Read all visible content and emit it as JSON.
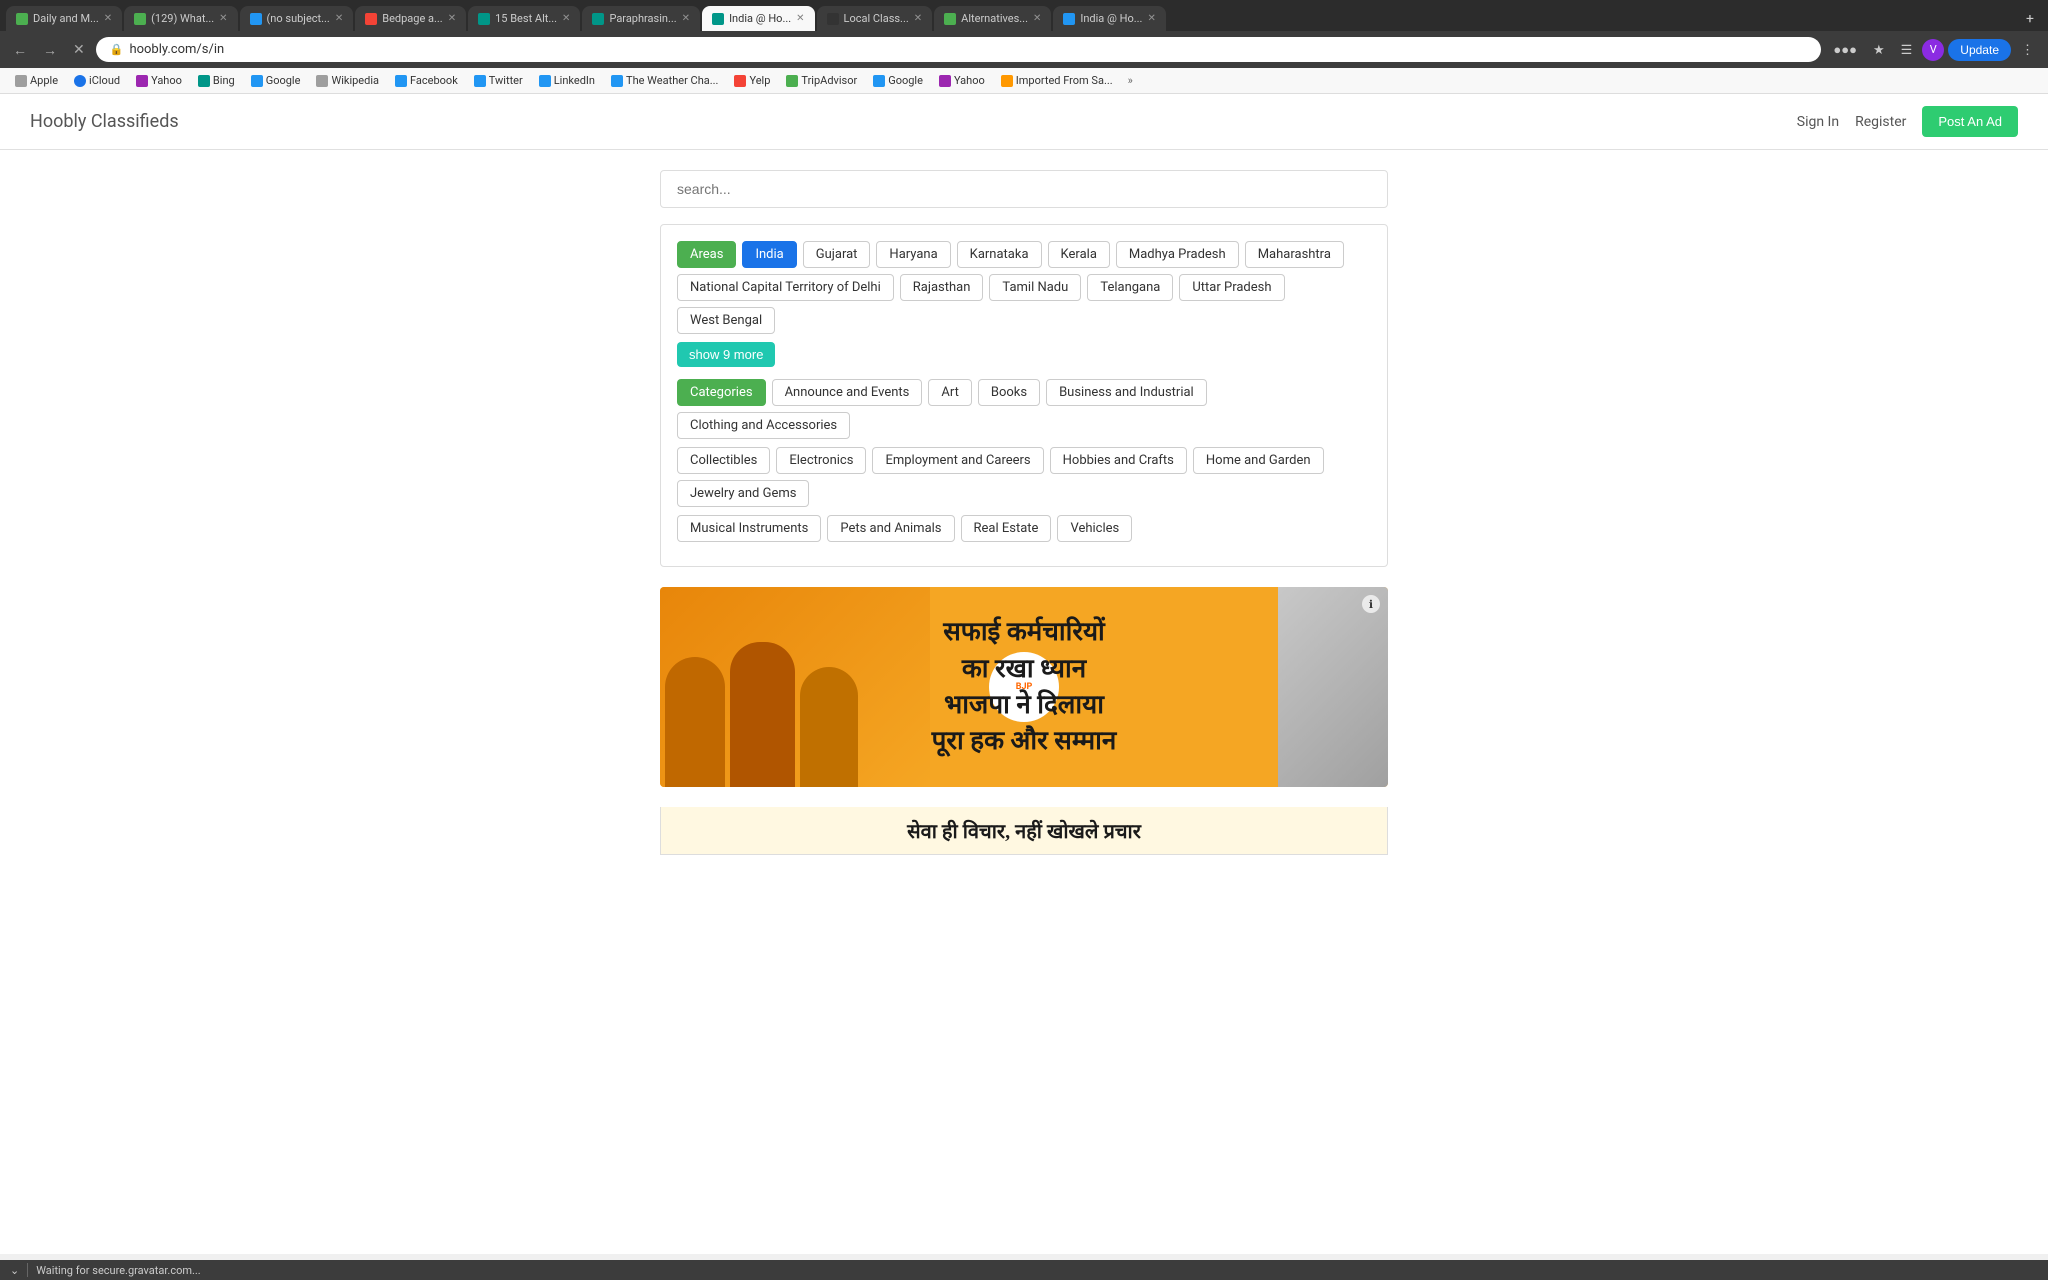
{
  "browser": {
    "tabs": [
      {
        "id": 1,
        "title": "Daily and M...",
        "favicon_color": "fav-green",
        "active": false,
        "closeable": true
      },
      {
        "id": 2,
        "title": "(129) What...",
        "favicon_color": "fav-green",
        "active": false,
        "closeable": true
      },
      {
        "id": 3,
        "title": "(no subject...",
        "favicon_color": "fav-blue",
        "active": false,
        "closeable": true
      },
      {
        "id": 4,
        "title": "Bedpage a...",
        "favicon_color": "fav-red",
        "active": false,
        "closeable": true
      },
      {
        "id": 5,
        "title": "15 Best Alt...",
        "favicon_color": "fav-teal",
        "active": false,
        "closeable": true
      },
      {
        "id": 6,
        "title": "Paraphrasin...",
        "favicon_color": "fav-teal",
        "active": false,
        "closeable": true
      },
      {
        "id": 7,
        "title": "India @ Ho...",
        "favicon_color": "fav-teal",
        "active": true,
        "closeable": true
      },
      {
        "id": 8,
        "title": "Local Class...",
        "favicon_color": "fav-dark",
        "active": false,
        "closeable": true
      },
      {
        "id": 9,
        "title": "Alternatives...",
        "favicon_color": "fav-green",
        "active": false,
        "closeable": true
      },
      {
        "id": 10,
        "title": "India @ Ho...",
        "favicon_color": "fav-blue",
        "active": false,
        "closeable": true
      }
    ],
    "url": "hoobly.com/s/in",
    "update_label": "Update"
  },
  "bookmarks": [
    {
      "label": "Apple",
      "favicon_color": "fav-gray"
    },
    {
      "label": "iCloud",
      "favicon_color": "fav-circle-blue"
    },
    {
      "label": "Yahoo",
      "favicon_color": "fav-purple"
    },
    {
      "label": "Bing",
      "favicon_color": "fav-teal"
    },
    {
      "label": "Google",
      "favicon_color": "fav-blue"
    },
    {
      "label": "Wikipedia",
      "favicon_color": "fav-gray"
    },
    {
      "label": "Facebook",
      "favicon_color": "fav-blue"
    },
    {
      "label": "Twitter",
      "favicon_color": "fav-blue"
    },
    {
      "label": "LinkedIn",
      "favicon_color": "fav-blue"
    },
    {
      "label": "The Weather Cha...",
      "favicon_color": "fav-blue"
    },
    {
      "label": "Yelp",
      "favicon_color": "fav-red"
    },
    {
      "label": "TripAdvisor",
      "favicon_color": "fav-green"
    },
    {
      "label": "Google",
      "favicon_color": "fav-blue"
    },
    {
      "label": "Yahoo",
      "favicon_color": "fav-purple"
    },
    {
      "label": "Imported From Sa...",
      "favicon_color": "fav-orange"
    }
  ],
  "site": {
    "logo": "Hoobly Classifieds",
    "sign_in": "Sign In",
    "register": "Register",
    "post_ad": "Post An Ad"
  },
  "search": {
    "placeholder": "search..."
  },
  "areas": {
    "label": "Areas",
    "active_area": "India",
    "tags": [
      "Areas",
      "India",
      "Gujarat",
      "Haryana",
      "Karnataka",
      "Kerala",
      "Madhya Pradesh",
      "Maharashtra",
      "National Capital Territory of Delhi",
      "Rajasthan",
      "Tamil Nadu",
      "Telangana",
      "Uttar Pradesh",
      "West Bengal"
    ],
    "show_more": "show 9 more"
  },
  "categories": {
    "label": "Categories",
    "tags": [
      "Categories",
      "Announce and Events",
      "Art",
      "Books",
      "Business and Industrial",
      "Clothing and Accessories",
      "Collectibles",
      "Electronics",
      "Employment and Careers",
      "Hobbies and Crafts",
      "Home and Garden",
      "Jewelry and Gems",
      "Musical Instruments",
      "Pets and Animals",
      "Real Estate",
      "Vehicles"
    ]
  },
  "ad": {
    "hindi_line1": "सफाई कर्मचारियों",
    "hindi_line2": "का रखा ध्यान",
    "hindi_line3": "भाजपा ने दिलाया",
    "hindi_line4": "पूरा हक और सम्मान",
    "bottom_text": "सेवा ही विचार, नहीं खोखले प्रचार",
    "info_label": "ℹ"
  },
  "status_bar": {
    "message": "Waiting for secure.gravatar.com..."
  }
}
